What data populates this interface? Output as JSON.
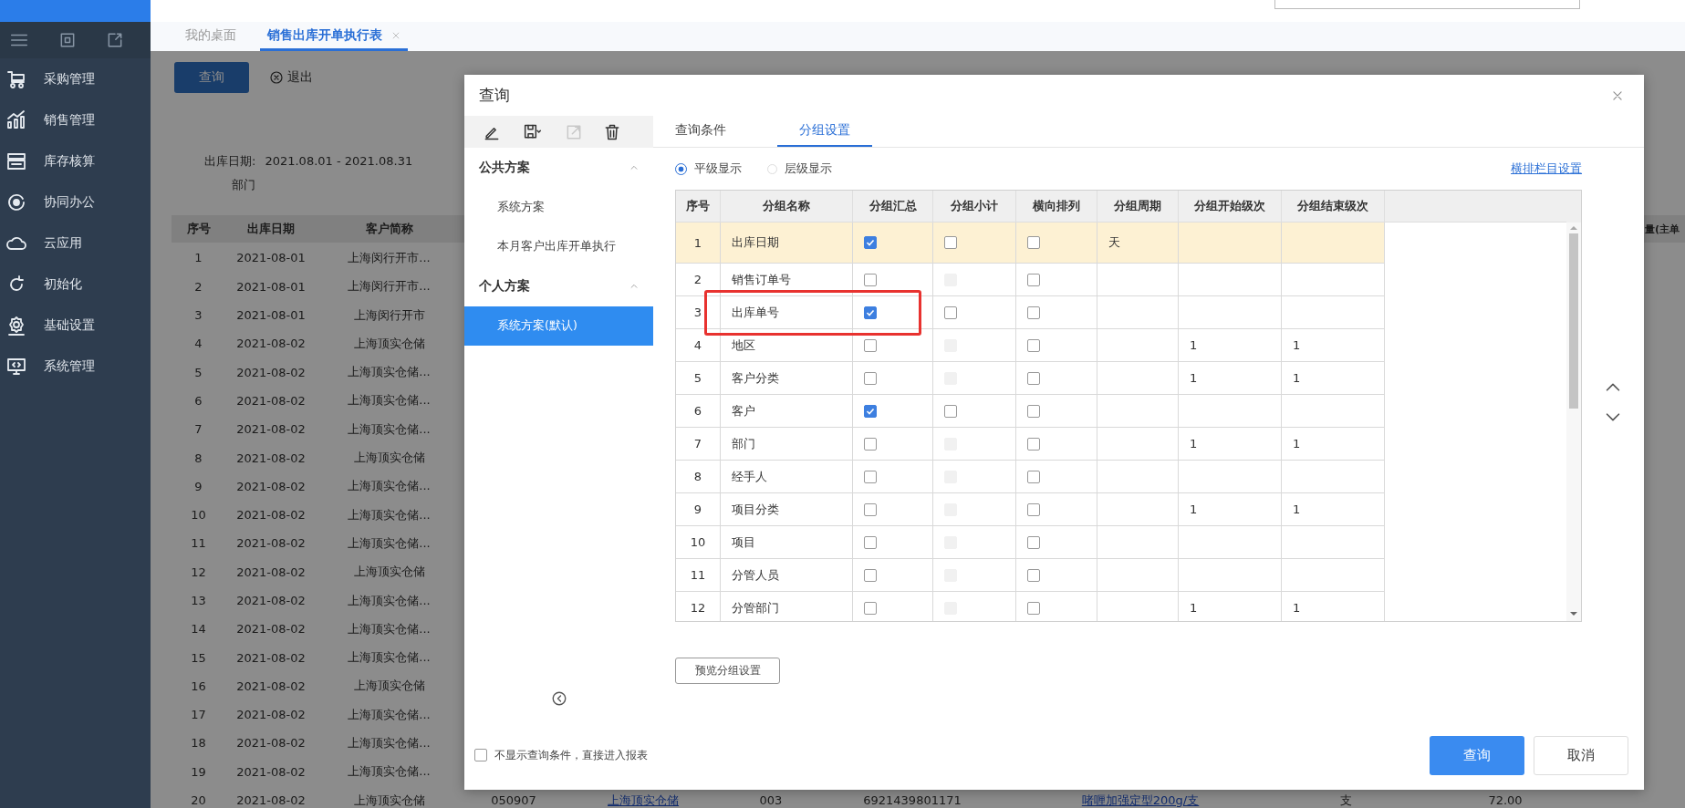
{
  "sidebar": {
    "menu": [
      "采购管理",
      "销售管理",
      "库存核算",
      "协同办公",
      "云应用",
      "初始化",
      "基础设置",
      "系统管理"
    ]
  },
  "tabs": [
    {
      "label": "我的桌面",
      "selected": false,
      "closable": false
    },
    {
      "label": "销售出库开单执行表",
      "selected": true,
      "closable": true
    }
  ],
  "report": {
    "query_button": "查询",
    "exit_button": "退出",
    "filters": [
      {
        "label": "出库日期:",
        "value": "2021.08.01 - 2021.08.31"
      },
      {
        "label": "部门"
      }
    ],
    "table": {
      "columns": [
        "序号",
        "出库日期",
        "客户简称"
      ],
      "right_header": "量(主单",
      "rows": [
        [
          "1",
          "2021-08-01",
          "上海闵行开市..."
        ],
        [
          "2",
          "2021-08-01",
          "上海闵行开市..."
        ],
        [
          "3",
          "2021-08-01",
          "上海闵行开市"
        ],
        [
          "4",
          "2021-08-02",
          "上海顶实仓储"
        ],
        [
          "5",
          "2021-08-02",
          "上海顶实仓储..."
        ],
        [
          "6",
          "2021-08-02",
          "上海顶实仓储..."
        ],
        [
          "7",
          "2021-08-02",
          "上海顶实仓储..."
        ],
        [
          "8",
          "2021-08-02",
          "上海顶实仓储"
        ],
        [
          "9",
          "2021-08-02",
          "上海顶实仓储..."
        ],
        [
          "10",
          "2021-08-02",
          "上海顶实仓储..."
        ],
        [
          "11",
          "2021-08-02",
          "上海顶实仓储..."
        ],
        [
          "12",
          "2021-08-02",
          "上海顶实仓储"
        ],
        [
          "13",
          "2021-08-02",
          "上海顶实仓储..."
        ],
        [
          "14",
          "2021-08-02",
          "上海顶实仓储..."
        ],
        [
          "15",
          "2021-08-02",
          "上海顶实仓储..."
        ],
        [
          "16",
          "2021-08-02",
          "上海顶实仓储"
        ],
        [
          "17",
          "2021-08-02",
          "上海顶实仓储..."
        ],
        [
          "18",
          "2021-08-02",
          "上海顶实仓储..."
        ],
        [
          "19",
          "2021-08-02",
          "上海顶实仓储..."
        ],
        [
          "20",
          "2021-08-02",
          "上海顶实仓储",
          "050907",
          {
            "text": "上海顶实仓储",
            "kind": "link"
          },
          "003",
          "6921439801171",
          {
            "text": "啫喱加强定型200g/支",
            "kind": "link"
          },
          "支",
          "72.00"
        ]
      ]
    }
  },
  "dialog": {
    "title": "查询",
    "toolbar": [
      {
        "kind": "edit",
        "disabled": false
      },
      {
        "kind": "save",
        "disabled": false
      },
      {
        "kind": "export",
        "disabled": true
      },
      {
        "kind": "delete",
        "disabled": false
      }
    ],
    "groups": [
      {
        "label": "公共方案",
        "expanded": true,
        "items": [
          {
            "label": "系统方案",
            "selected": false
          },
          {
            "label": "本月客户出库开单执行",
            "selected": false
          }
        ]
      },
      {
        "label": "个人方案",
        "expanded": true,
        "items": [
          {
            "label": "系统方案(默认)",
            "selected": true
          }
        ]
      }
    ],
    "tabs": [
      {
        "label": "查询条件",
        "selected": false
      },
      {
        "label": "分组设置",
        "selected": true
      }
    ],
    "display_modes": [
      {
        "label": "平级显示",
        "selected": true
      },
      {
        "label": "层级显示",
        "selected": false
      }
    ],
    "column_settings_link": "横排栏目设置",
    "grid": {
      "columns": [
        "序号",
        "分组名称",
        "分组汇总",
        "分组小计",
        "横向排列",
        "分组周期",
        "分组开始级次",
        "分组结束级次"
      ],
      "rows": [
        {
          "seq": "1",
          "name": "出库日期",
          "summary": true,
          "subtotal": false,
          "subtotal_disabled": false,
          "horizontal": false,
          "period": "天",
          "selected": true
        },
        {
          "seq": "2",
          "name": "销售订单号",
          "summary": false,
          "subtotal": false,
          "subtotal_disabled": true,
          "horizontal": false,
          "selected": false
        },
        {
          "seq": "3",
          "name": "出库单号",
          "summary": true,
          "subtotal": false,
          "subtotal_disabled": false,
          "horizontal": false,
          "selected": false,
          "marked": true
        },
        {
          "seq": "4",
          "name": "地区",
          "summary": false,
          "subtotal": false,
          "subtotal_disabled": true,
          "horizontal": false,
          "start_level": "1",
          "end_level": "1",
          "selected": false
        },
        {
          "seq": "5",
          "name": "客户分类",
          "summary": false,
          "subtotal": false,
          "subtotal_disabled": true,
          "horizontal": false,
          "start_level": "1",
          "end_level": "1",
          "selected": false
        },
        {
          "seq": "6",
          "name": "客户",
          "summary": true,
          "subtotal": false,
          "subtotal_disabled": false,
          "horizontal": false,
          "selected": false
        },
        {
          "seq": "7",
          "name": "部门",
          "summary": false,
          "subtotal": false,
          "subtotal_disabled": true,
          "horizontal": false,
          "start_level": "1",
          "end_level": "1",
          "selected": false
        },
        {
          "seq": "8",
          "name": "经手人",
          "summary": false,
          "subtotal": false,
          "subtotal_disabled": true,
          "horizontal": false,
          "selected": false
        },
        {
          "seq": "9",
          "name": "项目分类",
          "summary": false,
          "subtotal": false,
          "subtotal_disabled": true,
          "horizontal": false,
          "start_level": "1",
          "end_level": "1",
          "selected": false
        },
        {
          "seq": "10",
          "name": "项目",
          "summary": false,
          "subtotal": false,
          "subtotal_disabled": true,
          "horizontal": false,
          "selected": false
        },
        {
          "seq": "11",
          "name": "分管人员",
          "summary": false,
          "subtotal": false,
          "subtotal_disabled": true,
          "horizontal": false,
          "selected": false
        },
        {
          "seq": "12",
          "name": "分管部门",
          "summary": false,
          "subtotal": false,
          "subtotal_disabled": true,
          "horizontal": false,
          "start_level": "1",
          "end_level": "1",
          "selected": false
        }
      ]
    },
    "preview_button": "预览分组设置",
    "skip_option": {
      "label": "不显示查询条件，直接进入报表",
      "checked": false
    },
    "buttons": [
      {
        "label": "查询",
        "kind": "primary"
      },
      {
        "label": "取消",
        "kind": "secondary"
      }
    ]
  }
}
